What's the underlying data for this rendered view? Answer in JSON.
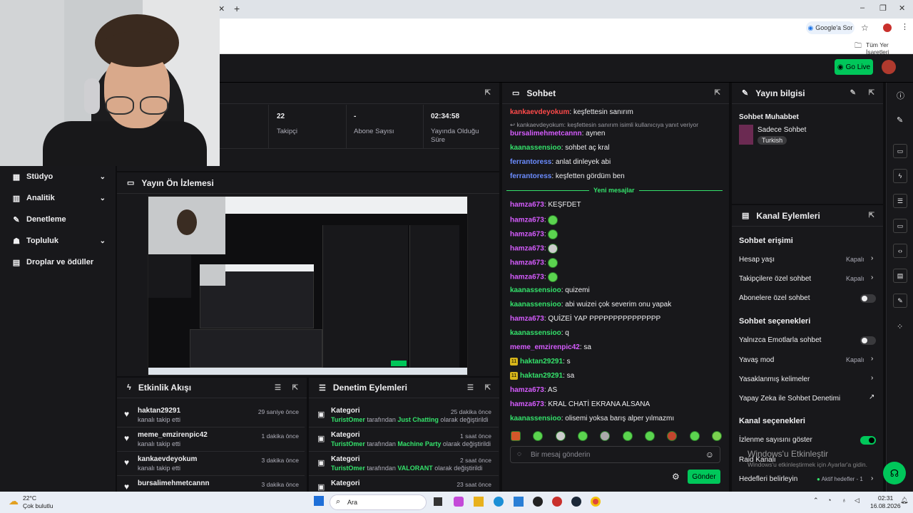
{
  "browser": {
    "google_button": "Google'a Sor",
    "bookmarks_label": "Tüm Yer İşaretleri"
  },
  "topnav": {
    "go_live": "Go Live"
  },
  "sidebar": {
    "items": [
      {
        "label": "Stüdyo",
        "icon": "studio-icon"
      },
      {
        "label": "Analitik",
        "icon": "analytics-icon"
      },
      {
        "label": "Denetleme",
        "icon": "wrench-icon"
      },
      {
        "label": "Topluluk",
        "icon": "community-icon"
      },
      {
        "label": "Droplar ve ödüller",
        "icon": "gift-icon"
      }
    ]
  },
  "stats": [
    {
      "value": "22",
      "label": "Takipçi"
    },
    {
      "value": "-",
      "label": "Abone Sayısı"
    },
    {
      "value": "02:34:58",
      "label": "Yayında Olduğu Süre"
    }
  ],
  "preview": {
    "title": "Yayın Ön İzlemesi"
  },
  "activity": {
    "title": "Etkinlik Akışı",
    "rows": [
      {
        "name": "haktan29291",
        "sub": "kanalı takip etti",
        "time": "29 saniye önce"
      },
      {
        "name": "meme_emzirenpic42",
        "sub": "kanalı takip etti",
        "time": "1 dakika önce"
      },
      {
        "name": "kankaevdeyokum",
        "sub": "kanalı takip etti",
        "time": "3 dakika önce"
      },
      {
        "name": "bursalimehmetcannn",
        "sub": "",
        "time": "3 dakika önce"
      }
    ]
  },
  "modactions": {
    "title": "Denetim Eylemleri",
    "rows": [
      {
        "name": "Kategori",
        "user": "TuristOmer",
        "mid": " tarafından ",
        "target": "Just Chatting",
        "end": " olarak değiştirildi",
        "time": "25 dakika önce"
      },
      {
        "name": "Kategori",
        "user": "TuristOmer",
        "mid": " tarafından ",
        "target": "Machine Party",
        "end": " olarak değiştirildi",
        "time": "1 saat önce"
      },
      {
        "name": "Kategori",
        "user": "TuristOmer",
        "mid": " tarafından ",
        "target": "VALORANT",
        "end": " olarak değiştirildi",
        "time": "2 saat önce"
      },
      {
        "name": "Kategori",
        "user": "",
        "mid": "",
        "target": "",
        "end": "",
        "time": "23 saat önce"
      }
    ]
  },
  "chat": {
    "title": "Sohbet",
    "reply_note": "kankaevdeyokum: keşfettesin sanırım isimli kullanıcıya yanıt veriyor",
    "new_messages": "Yeni mesajlar",
    "input_placeholder": "Bir mesaj gönderin",
    "send": "Gönder",
    "messages": [
      {
        "user": "kankaevdeyokum",
        "color": "#ff4a4a",
        "text": ": keşfettesin sanırım"
      },
      {
        "user": "bursalimehmetcannn",
        "color": "#d65cff",
        "text": ": aynen"
      },
      {
        "user": "kaanassensioo",
        "color": "#34e26b",
        "text": ": sohbet aç kral"
      },
      {
        "user": "ferrantoress",
        "color": "#6b8cff",
        "text": ": anlat dinleyek abi"
      },
      {
        "user": "ferrantoress",
        "color": "#6b8cff",
        "text": ": keşfetten gördüm ben"
      },
      {
        "user": "hamza673",
        "color": "#d65cff",
        "text": ": KEŞFDET"
      },
      {
        "user": "hamza673",
        "color": "#d65cff",
        "text": ":"
      },
      {
        "user": "hamza673",
        "color": "#d65cff",
        "text": ":"
      },
      {
        "user": "hamza673",
        "color": "#d65cff",
        "text": ":"
      },
      {
        "user": "hamza673",
        "color": "#d65cff",
        "text": ":"
      },
      {
        "user": "hamza673",
        "color": "#d65cff",
        "text": ":"
      },
      {
        "user": "kaanassensioo",
        "color": "#34e26b",
        "text": ": quizemi"
      },
      {
        "user": "kaanassensioo",
        "color": "#34e26b",
        "text": ": abi wuizei çok severim onu yapak"
      },
      {
        "user": "hamza673",
        "color": "#d65cff",
        "text": ": QUİZEİ YAP PPPPPPPPPPPPPPP"
      },
      {
        "user": "kaanassensioo",
        "color": "#34e26b",
        "text": ": q"
      },
      {
        "user": "meme_emzirenpic42",
        "color": "#d65cff",
        "text": ": sa"
      },
      {
        "user": "haktan29291",
        "color": "#34e26b",
        "text": ": s",
        "badge": "11"
      },
      {
        "user": "haktan29291",
        "color": "#34e26b",
        "text": ": sa",
        "badge": "11"
      },
      {
        "user": "hamza673",
        "color": "#d65cff",
        "text": ": AS"
      },
      {
        "user": "hamza673",
        "color": "#d65cff",
        "text": ": KRAL CHATİ EKRANA ALSANA"
      },
      {
        "user": "kaanassensioo",
        "color": "#34e26b",
        "text": ": olisemi yoksa barış alper yılmazmı"
      }
    ]
  },
  "streaminfo": {
    "title": "Yayın bilgisi",
    "stream_title": "Sohbet Muhabbet",
    "category": "Sadece Sohbet",
    "tag": "Turkish"
  },
  "channel": {
    "title": "Kanal Eylemleri",
    "chat_access": "Sohbet erişimi",
    "account_age": "Hesap yaşı",
    "account_age_val": "Kapalı",
    "followers_only": "Takipçilere özel sohbet",
    "followers_only_val": "Kapalı",
    "subs_only": "Abonelere özel sohbet",
    "chat_options": "Sohbet seçenekleri",
    "emote_only": "Yalnızca Emotlarla sohbet",
    "slow_mode": "Yavaş mod",
    "slow_mode_val": "Kapalı",
    "banned_words": "Yasaklanmış kelimeler",
    "ai_moderation": "Yapay Zeka ile Sohbet Denetimi",
    "channel_options": "Kanal seçenekleri",
    "show_viewers": "İzlenme sayısını göster",
    "raid": "Raid Kanalı",
    "set_goals": "Hedefleri belirleyin",
    "active_goals": "Aktif hedefler - 1"
  },
  "watermark": {
    "line1": "Windows'u Etkinleştir",
    "line2": "Windows'u etkinleştirmek için Ayarlar'a gidin."
  },
  "taskbar": {
    "temp": "22°C",
    "weather": "Çok bulutlu",
    "search": "Ara",
    "time": "02:31",
    "date": "16.08.2026"
  }
}
